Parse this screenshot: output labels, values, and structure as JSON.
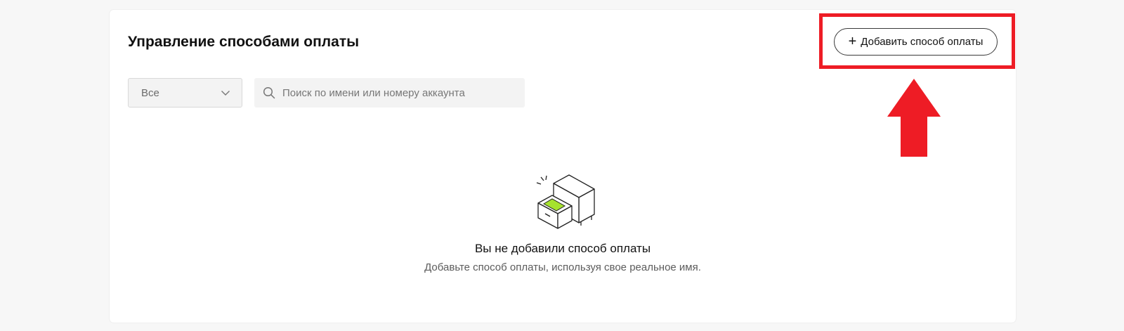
{
  "header": {
    "title": "Управление способами оплаты",
    "add_button_label": "Добавить способ оплаты"
  },
  "filters": {
    "select_value": "Все",
    "search_placeholder": "Поиск по имени или номеру аккаунта",
    "search_value": ""
  },
  "empty_state": {
    "title": "Вы не добавили способ оплаты",
    "subtitle": "Добавьте способ оплаты, используя свое реальное имя."
  },
  "icons": {
    "add": "plus-icon",
    "select": "chevron-down-icon",
    "search": "search-icon",
    "empty": "empty-drawer-icon",
    "annotation": "red-arrow-up"
  },
  "colors": {
    "annotation": "#ee1c25",
    "accent": "#a6e22e",
    "background": "#f7f7f7",
    "card": "#ffffff"
  }
}
